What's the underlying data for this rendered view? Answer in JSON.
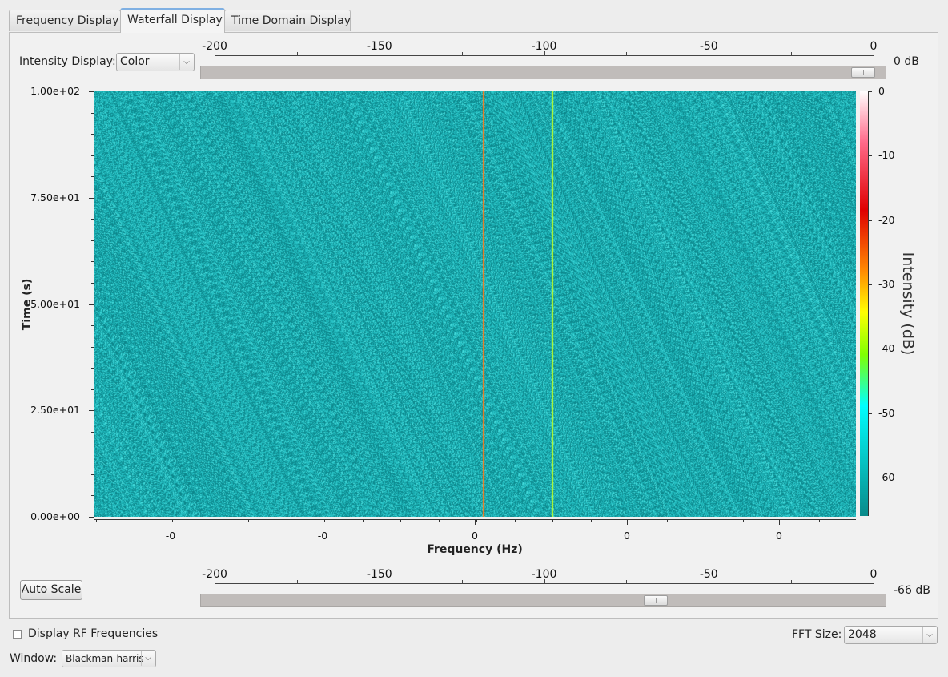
{
  "tabs": [
    {
      "label": "Frequency Display",
      "active": false
    },
    {
      "label": "Waterfall Display",
      "active": true
    },
    {
      "label": "Time Domain Display",
      "active": false
    }
  ],
  "intensity_display": {
    "label": "Intensity Display:",
    "value": "Color"
  },
  "top_slider": {
    "ticks": [
      "-200",
      "-150",
      "-100",
      "-50",
      "0"
    ],
    "value_label": "0 dB",
    "value_db": 0
  },
  "bottom_slider": {
    "ticks": [
      "-200",
      "-150",
      "-100",
      "-50",
      "0"
    ],
    "value_label": "-66 dB",
    "value_db": -66
  },
  "colors": {
    "background": "#1aa8ac",
    "signal_1": "#ff7a1a",
    "signal_2": "#b8ff2a"
  },
  "chart_data": {
    "type": "heatmap",
    "title": "",
    "xlabel": "Frequency (Hz)",
    "ylabel": "Time (s)",
    "colorbar_label": "Intensity (dB)",
    "y_ticks": [
      "1.00e+02",
      "7.50e+01",
      "5.00e+01",
      "2.50e+01",
      "0.00e+00"
    ],
    "y_tick_values": [
      100,
      75,
      50,
      25,
      0
    ],
    "x_ticks": [
      "-0",
      "-0",
      "0",
      "0",
      "0"
    ],
    "colorbar_ticks": [
      "0",
      "-10",
      "-20",
      "-30",
      "-40",
      "-50",
      "-60"
    ],
    "colorbar_range": [
      -66,
      0
    ],
    "ylim": [
      0,
      100
    ],
    "noise_floor_color": "#1aa8ac",
    "carriers": [
      {
        "x_fraction": 0.511,
        "color": "#ff7a1a"
      },
      {
        "x_fraction": 0.601,
        "color": "#b8ff2a"
      }
    ]
  },
  "auto_scale_label": "Auto Scale",
  "rf_checkbox": {
    "label": "Display RF Frequencies",
    "checked": false
  },
  "fft_size": {
    "label": "FFT Size:",
    "value": "2048"
  },
  "window": {
    "label": "Window:",
    "value": "Blackman-harris"
  }
}
